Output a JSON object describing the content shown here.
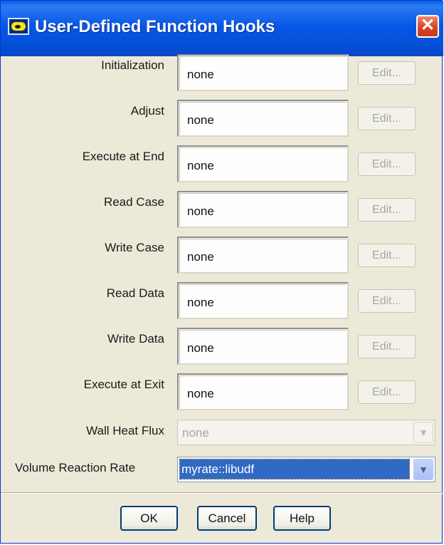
{
  "window": {
    "title": "User-Defined Function Hooks",
    "close_glyph": "✕",
    "icon": "fluent-app-icon"
  },
  "hooks": [
    {
      "label": "Initialization",
      "value": "none",
      "edit_label": "Edit..."
    },
    {
      "label": "Adjust",
      "value": "none",
      "edit_label": "Edit..."
    },
    {
      "label": "Execute at End",
      "value": "none",
      "edit_label": "Edit..."
    },
    {
      "label": "Read Case",
      "value": "none",
      "edit_label": "Edit..."
    },
    {
      "label": "Write Case",
      "value": "none",
      "edit_label": "Edit..."
    },
    {
      "label": "Read Data",
      "value": "none",
      "edit_label": "Edit..."
    },
    {
      "label": "Write Data",
      "value": "none",
      "edit_label": "Edit..."
    },
    {
      "label": "Execute at Exit",
      "value": "none",
      "edit_label": "Edit..."
    }
  ],
  "wall_heat_flux": {
    "label": "Wall Heat Flux",
    "value": "none",
    "enabled": false
  },
  "volume_reaction_rate": {
    "label": "Volume Reaction Rate",
    "value": "myrate::libudf",
    "enabled": true
  },
  "buttons": {
    "ok": "OK",
    "cancel": "Cancel",
    "help": "Help"
  },
  "colors": {
    "titlebar": "#0a5fe6",
    "dialog_bg": "#ece9d8",
    "selection": "#316ac5",
    "close_button": "#d74428"
  }
}
